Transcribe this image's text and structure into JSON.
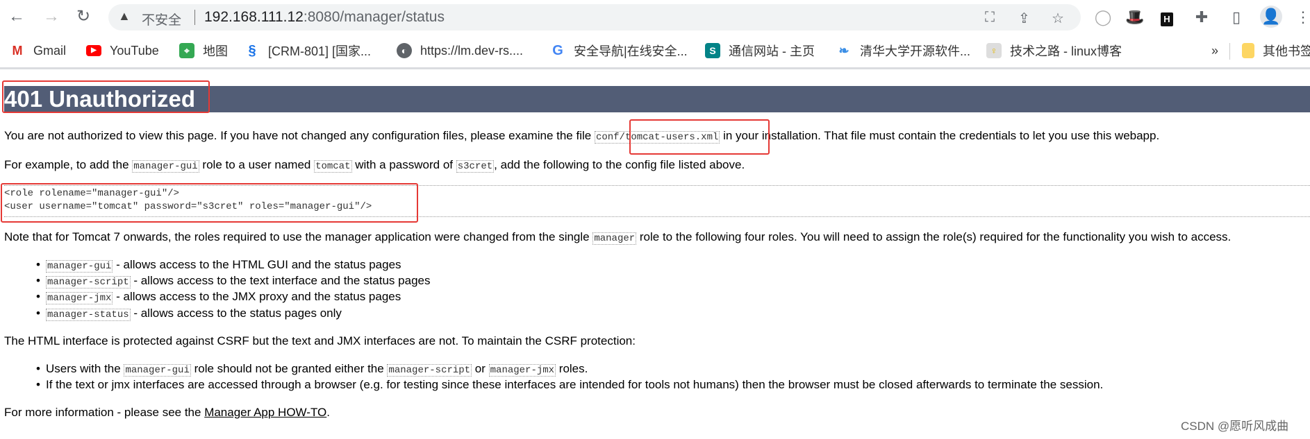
{
  "browser": {
    "insecure_label": "不安全",
    "url_host": "192.168.111.12",
    "url_rest": ":8080/manager/status",
    "bookmarks": [
      {
        "label": "Gmail",
        "icon": "gmail-icon"
      },
      {
        "label": "YouTube",
        "icon": "youtube-icon"
      },
      {
        "label": "地图",
        "icon": "maps-icon"
      },
      {
        "label": "[CRM-801] [国家...",
        "icon": "jira-icon"
      },
      {
        "label": "https://lm.dev-rs....",
        "icon": "globe-icon"
      },
      {
        "label": "安全导航|在线安全...",
        "icon": "google-icon"
      },
      {
        "label": "通信网站 - 主页",
        "icon": "sharepoint-icon"
      },
      {
        "label": "清华大学开源软件...",
        "icon": "tuna-icon"
      },
      {
        "label": "技术之路 - linux博客",
        "icon": "bulb-icon"
      }
    ],
    "more_bookmarks": "»",
    "other_bookmarks": "其他书签"
  },
  "page": {
    "title": "401 Unauthorized",
    "p1_before": "You are not authorized to view this page. If you have not changed any configuration files, please examine the file ",
    "p1_code": "conf/tomcat-users.xml",
    "p1_after": " in your installation. That file must contain the credentials to let you use this webapp.",
    "p2": [
      "For example, to add the ",
      "manager-gui",
      " role to a user named ",
      "tomcat",
      " with a password of ",
      "s3cret",
      ", add the following to the config file listed above."
    ],
    "pre_lines": [
      "<role rolename=\"manager-gui\"/>",
      "<user username=\"tomcat\" password=\"s3cret\" roles=\"manager-gui\"/>"
    ],
    "p3_before": "Note that for Tomcat 7 onwards, the roles required to use the manager application were changed from the single ",
    "p3_code": "manager",
    "p3_after": " role to the following four roles. You will need to assign the role(s) required for the functionality you wish to access.",
    "roles": [
      {
        "code": "manager-gui",
        "text": " - allows access to the HTML GUI and the status pages"
      },
      {
        "code": "manager-script",
        "text": " - allows access to the text interface and the status pages"
      },
      {
        "code": "manager-jmx",
        "text": " - allows access to the JMX proxy and the status pages"
      },
      {
        "code": "manager-status",
        "text": " - allows access to the status pages only"
      }
    ],
    "p4": "The HTML interface is protected against CSRF but the text and JMX interfaces are not. To maintain the CSRF protection:",
    "csrf1": [
      "Users with the ",
      "manager-gui",
      " role should not be granted either the ",
      "manager-script",
      " or ",
      "manager-jmx",
      " roles."
    ],
    "csrf2": "If the text or jmx interfaces are accessed through a browser (e.g. for testing since these interfaces are intended for tools not humans) then the browser must be closed afterwards to terminate the session.",
    "p5_before": "For more information - please see the ",
    "p5_link": "Manager App HOW-TO",
    "p5_after": "."
  },
  "watermark": "CSDN @愿听风成曲",
  "colors": {
    "title_bar": "#525d76",
    "annotation_box": "#e53935"
  }
}
